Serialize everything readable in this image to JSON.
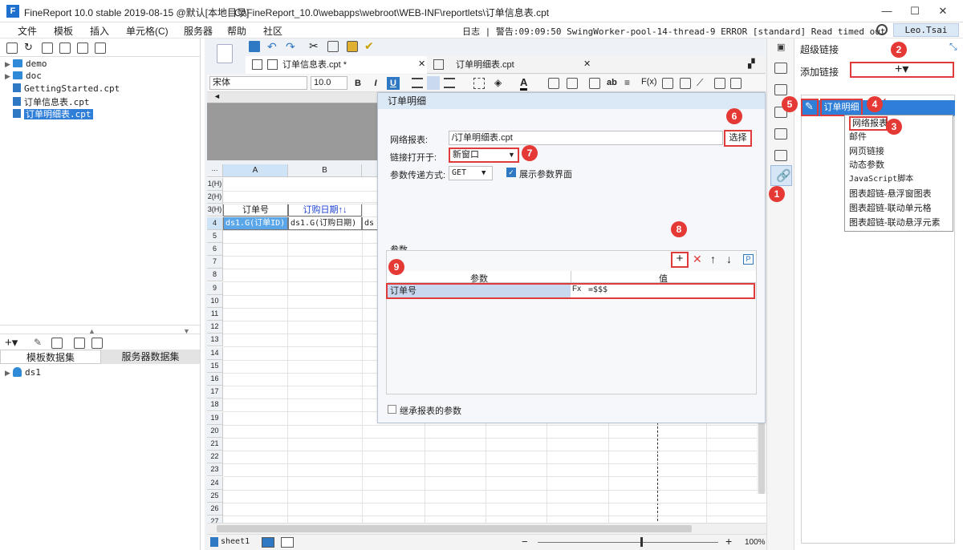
{
  "window": {
    "title": "FineReport 10.0 stable 2019-08-15 @默认[本地目录]",
    "path": "C:\\FineReport_10.0\\webapps\\webroot\\WEB-INF\\reportlets\\订单信息表.cpt",
    "min": "—",
    "max": "☐",
    "close": "✕"
  },
  "menu": [
    "文件",
    "模板",
    "插入",
    "单元格(C)",
    "服务器",
    "帮助",
    "社区"
  ],
  "log": "日志 | 警告:09:09:50 SwingWorker-pool-14-thread-9 ERROR [standard] Read timed out",
  "user": "Leo.Tsai",
  "tree": [
    {
      "label": "demo",
      "type": "folder"
    },
    {
      "label": "doc",
      "type": "folder"
    },
    {
      "label": "GettingStarted.cpt",
      "type": "file"
    },
    {
      "label": "订单信息表.cpt",
      "type": "file"
    },
    {
      "label": "订单明细表.cpt",
      "type": "file",
      "selected": true
    }
  ],
  "dataset_tabs": [
    "模板数据集",
    "服务器数据集"
  ],
  "datasets": [
    "ds1"
  ],
  "doc_tabs": [
    "订单信息表.cpt *",
    "订单明细表.cpt"
  ],
  "font": {
    "family": "宋体",
    "size": "10.0"
  },
  "format_btns": [
    "B",
    "I",
    "U"
  ],
  "columns": [
    "A",
    "B"
  ],
  "rows": [
    "1(H)",
    "2(H)",
    "3(H)",
    "4",
    "5",
    "6",
    "7",
    "8",
    "9",
    "10",
    "11",
    "12",
    "13",
    "14",
    "15",
    "16",
    "17",
    "18",
    "19",
    "20",
    "21",
    "22",
    "23",
    "24",
    "25",
    "26",
    "27"
  ],
  "cells": {
    "r3a": "订单号",
    "r3b": "订购日期↑↓",
    "r4a": "ds1.G(订单ID)",
    "r4b": "ds1.G(订购日期)",
    "r4c": "ds"
  },
  "sheet": "sheet1",
  "zoom": "100%",
  "dialog": {
    "title": "订单明细",
    "report_label": "网络报表:",
    "report_value": "/订单明细表.cpt",
    "select_btn": "选择",
    "open_label": "链接打开于:",
    "open_value": "新窗口",
    "method_label": "参数传递方式:",
    "method_value": "GET",
    "show_params_label": "展示参数界面",
    "params_title": "参数",
    "col_param": "参数",
    "col_value": "值",
    "param_row": {
      "name": "订单号",
      "value": "=$$$"
    },
    "inherit_label": "继承报表的参数"
  },
  "hyperlink": {
    "title": "超级链接",
    "add_label": "添加链接",
    "item": "订单明细",
    "menu": [
      "网络报表",
      "邮件",
      "网页链接",
      "动态参数",
      "JavaScript脚本",
      "图表超链-悬浮窗图表",
      "图表超链-联动单元格",
      "图表超链-联动悬浮元素"
    ]
  },
  "badges": [
    "1",
    "2",
    "3",
    "4",
    "5",
    "6",
    "7",
    "8",
    "9"
  ],
  "colors": {
    "accent": "#1f6fcf",
    "badge": "#e53935",
    "select": "#2f7ed8"
  }
}
